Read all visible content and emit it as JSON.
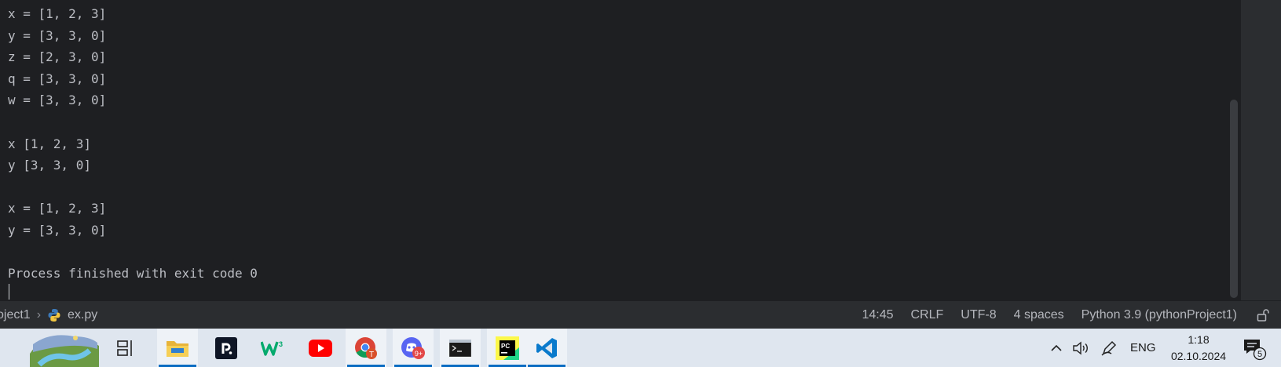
{
  "console": {
    "lines": [
      "x = [1, 2, 3]",
      "y = [3, 3, 0]",
      "z = [2, 3, 0]",
      "q = [3, 3, 0]",
      "w = [3, 3, 0]",
      "",
      "x [1, 2, 3]",
      "y [3, 3, 0]",
      "",
      "x = [1, 2, 3]",
      "y = [3, 3, 0]",
      "",
      "Process finished with exit code 0"
    ]
  },
  "statusbar": {
    "project": "oject1",
    "file": "ex.py",
    "position": "14:45",
    "line_ending": "CRLF",
    "encoding": "UTF-8",
    "indent": "4 spaces",
    "interpreter": "Python 3.9 (pythonProject1)"
  },
  "taskbar": {
    "apps": [
      "start-landscape",
      "task-view",
      "file-explorer",
      "replit",
      "w3schools",
      "youtube",
      "chrome",
      "discord",
      "terminal",
      "pycharm",
      "vscode"
    ],
    "chrome_badge": "T",
    "discord_badge": "9+",
    "language": "ENG",
    "time": "1:18",
    "date": "02.10.2024",
    "notifications": "5",
    "accent": "#0a6cc2"
  }
}
